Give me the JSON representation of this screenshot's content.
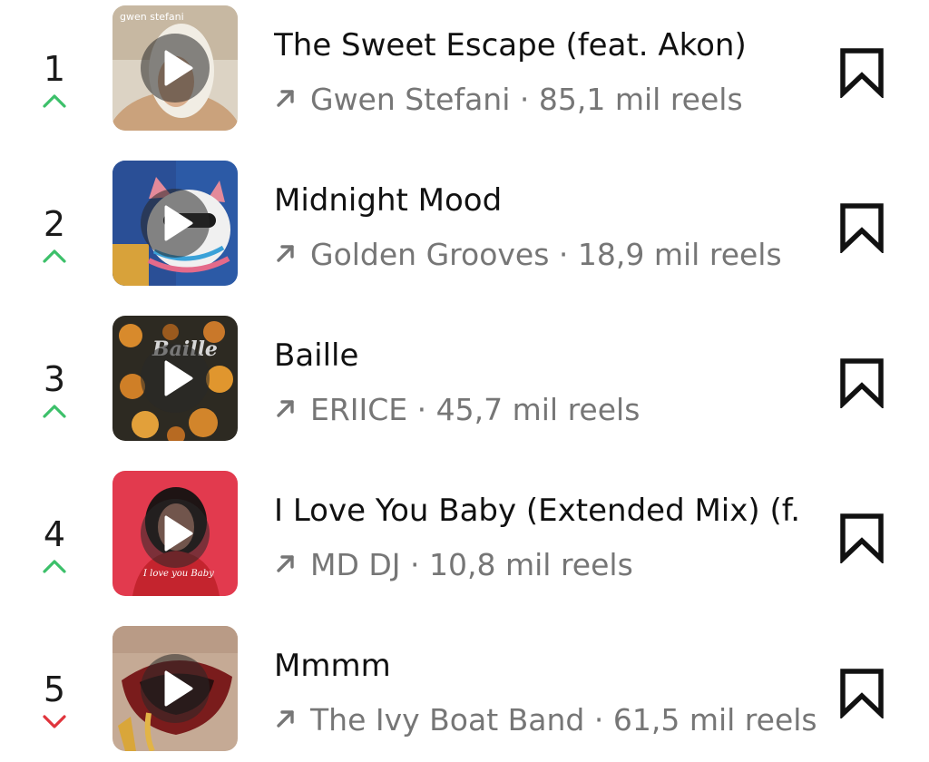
{
  "colors": {
    "trend_up": "#3cc06a",
    "trend_down": "#e0343c",
    "title_text": "#111111",
    "meta_text": "#767676"
  },
  "tracks": [
    {
      "rank": "1",
      "trend": "up",
      "title": "The Sweet Escape (feat. Akon)",
      "artist": "Gwen Stefani",
      "separator": "·",
      "reels": "85,1 mil reels",
      "cover_text": "gwen stefani"
    },
    {
      "rank": "2",
      "trend": "up",
      "title": "Midnight Mood",
      "artist": "Golden Grooves",
      "separator": "·",
      "reels": "18,9 mil reels"
    },
    {
      "rank": "3",
      "trend": "up",
      "title": "Baille",
      "artist": "ERIICE",
      "separator": "·",
      "reels": "45,7 mil reels",
      "cover_text": "Baille"
    },
    {
      "rank": "4",
      "trend": "up",
      "title": "I Love You Baby (Extended Mix) (f...",
      "artist": "MD DJ",
      "separator": "·",
      "reels": "10,8 mil reels",
      "cover_text": "I love you Baby"
    },
    {
      "rank": "5",
      "trend": "down",
      "title": "Mmmm",
      "artist": "The Ivy Boat Band",
      "separator": "·",
      "reels": "61,5 mil reels"
    }
  ]
}
